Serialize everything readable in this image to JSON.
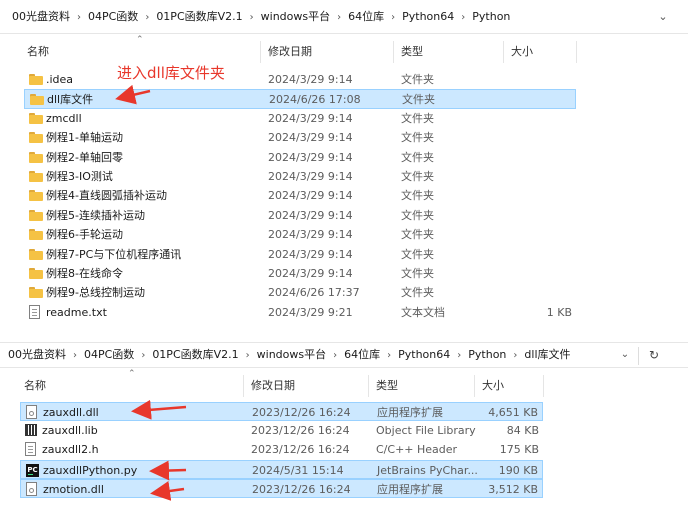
{
  "top": {
    "breadcrumbs": [
      "00光盘资料",
      "04PC函数",
      "01PC函数库V2.1",
      "windows平台",
      "64位库",
      "Python64",
      "Python"
    ],
    "columns": {
      "name": "名称",
      "date": "修改日期",
      "type": "类型",
      "size": "大小"
    },
    "annotation": "进入dll库文件夹",
    "rows": [
      {
        "name": ".idea",
        "date": "2024/3/29 9:14",
        "type": "文件夹",
        "size": "",
        "icon": "folder-icon"
      },
      {
        "name": "dll库文件",
        "date": "2024/6/26 17:08",
        "type": "文件夹",
        "size": "",
        "icon": "folder-icon",
        "selected": true
      },
      {
        "name": "zmcdll",
        "date": "2024/3/29 9:14",
        "type": "文件夹",
        "size": "",
        "icon": "folder-icon"
      },
      {
        "name": "例程1-单轴运动",
        "date": "2024/3/29 9:14",
        "type": "文件夹",
        "size": "",
        "icon": "folder-icon"
      },
      {
        "name": "例程2-单轴回零",
        "date": "2024/3/29 9:14",
        "type": "文件夹",
        "size": "",
        "icon": "folder-icon"
      },
      {
        "name": "例程3-IO测试",
        "date": "2024/3/29 9:14",
        "type": "文件夹",
        "size": "",
        "icon": "folder-icon"
      },
      {
        "name": "例程4-直线圆弧插补运动",
        "date": "2024/3/29 9:14",
        "type": "文件夹",
        "size": "",
        "icon": "folder-icon"
      },
      {
        "name": "例程5-连续插补运动",
        "date": "2024/3/29 9:14",
        "type": "文件夹",
        "size": "",
        "icon": "folder-icon"
      },
      {
        "name": "例程6-手轮运动",
        "date": "2024/3/29 9:14",
        "type": "文件夹",
        "size": "",
        "icon": "folder-icon"
      },
      {
        "name": "例程7-PC与下位机程序通讯",
        "date": "2024/3/29 9:14",
        "type": "文件夹",
        "size": "",
        "icon": "folder-icon"
      },
      {
        "name": "例程8-在线命令",
        "date": "2024/3/29 9:14",
        "type": "文件夹",
        "size": "",
        "icon": "folder-icon"
      },
      {
        "name": "例程9-总线控制运动",
        "date": "2024/6/26 17:37",
        "type": "文件夹",
        "size": "",
        "icon": "folder-icon"
      },
      {
        "name": "readme.txt",
        "date": "2024/3/29 9:21",
        "type": "文本文档",
        "size": "1 KB",
        "icon": "text-file-icon"
      }
    ]
  },
  "bottom": {
    "breadcrumbs": [
      "00光盘资料",
      "04PC函数",
      "01PC函数库V2.1",
      "windows平台",
      "64位库",
      "Python64",
      "Python",
      "dll库文件"
    ],
    "columns": {
      "name": "名称",
      "date": "修改日期",
      "type": "类型",
      "size": "大小"
    },
    "rows": [
      {
        "name": "zauxdll.dll",
        "date": "2023/12/26 16:24",
        "type": "应用程序扩展",
        "size": "4,651 KB",
        "icon": "dll-file-icon",
        "selected": true
      },
      {
        "name": "zauxdll.lib",
        "date": "2023/12/26 16:24",
        "type": "Object File Library",
        "size": "84 KB",
        "icon": "lib-file-icon"
      },
      {
        "name": "zauxdll2.h",
        "date": "2023/12/26 16:24",
        "type": "C/C++ Header",
        "size": "175 KB",
        "icon": "header-file-icon"
      },
      {
        "name": "zauxdllPython.py",
        "date": "2024/5/31 15:14",
        "type": "JetBrains PyChar...",
        "size": "190 KB",
        "icon": "pycharm-file-icon",
        "selected": true
      },
      {
        "name": "zmotion.dll",
        "date": "2023/12/26 16:24",
        "type": "应用程序扩展",
        "size": "3,512 KB",
        "icon": "dll-file-icon",
        "selected": true
      }
    ]
  },
  "icons": {
    "dropdown": "chevron-down-icon",
    "refresh": "refresh-icon",
    "separator": "chevron-right-icon"
  },
  "colors": {
    "selection": "#cce8ff",
    "selection_border": "#99d1ff",
    "annotation": "#e8372b",
    "folder": "#f5c244"
  }
}
